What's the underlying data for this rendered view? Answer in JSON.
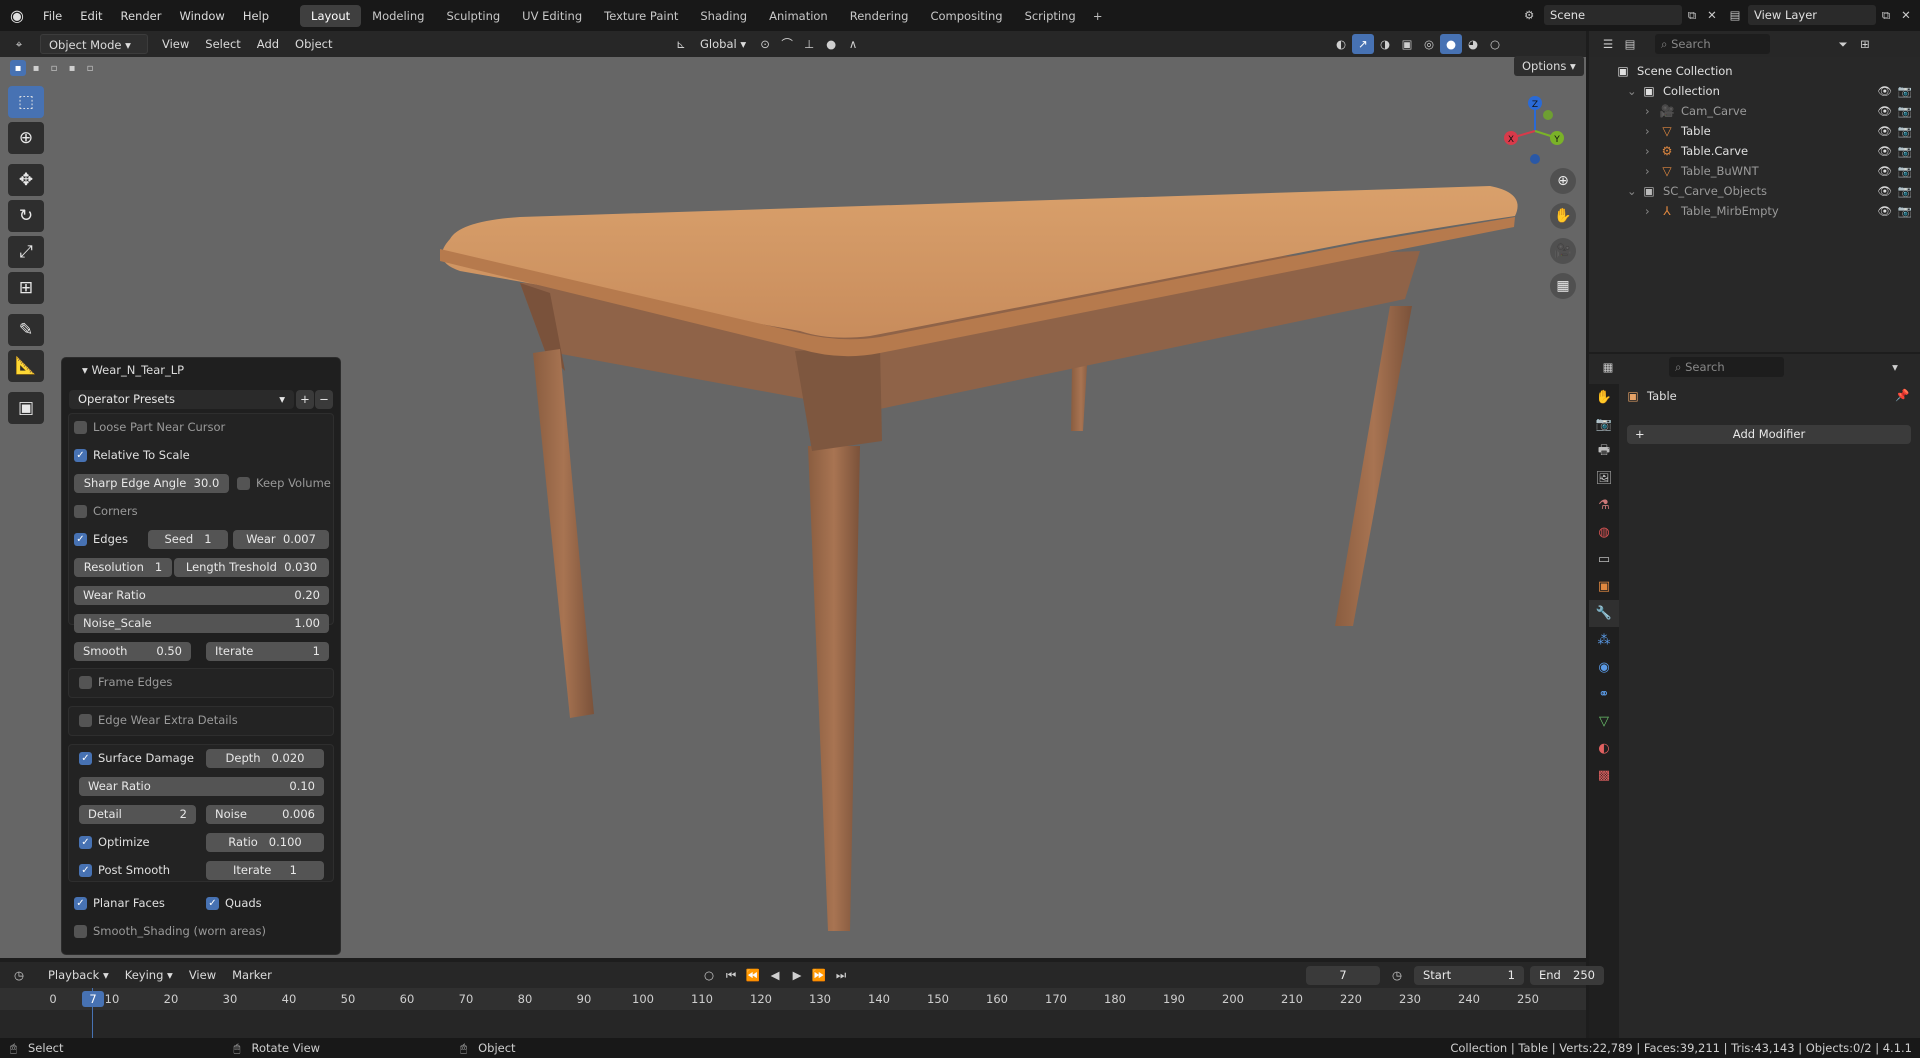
{
  "menu": [
    "File",
    "Edit",
    "Render",
    "Window",
    "Help"
  ],
  "workspaces": [
    {
      "label": "Layout",
      "active": true
    },
    {
      "label": "Modeling"
    },
    {
      "label": "Sculpting"
    },
    {
      "label": "UV Editing"
    },
    {
      "label": "Texture Paint"
    },
    {
      "label": "Shading"
    },
    {
      "label": "Animation"
    },
    {
      "label": "Rendering"
    },
    {
      "label": "Compositing"
    },
    {
      "label": "Scripting"
    }
  ],
  "scene_name": "Scene",
  "view_layer": "View Layer",
  "viewport": {
    "mode": "Object Mode",
    "menus": [
      "View",
      "Select",
      "Add",
      "Object"
    ],
    "transform_orientation": "Global",
    "options_label": "Options",
    "gizmo": {
      "x": "X",
      "y": "Y",
      "z": "Z"
    }
  },
  "operator_panel": {
    "title": "Wear_N_Tear_LP",
    "presets": "Operator Presets",
    "loose_part": "Loose Part Near Cursor",
    "relative_scale": "Relative To Scale",
    "sharp_edge": {
      "label": "Sharp Edge Angle",
      "value": "30.0"
    },
    "keep_volume": "Keep Volume",
    "corners": "Corners",
    "edges": "Edges",
    "seed": {
      "label": "Seed",
      "value": "1"
    },
    "wear": {
      "label": "Wear",
      "value": "0.007"
    },
    "resolution": {
      "label": "Resolution",
      "value": "1"
    },
    "length_threshold": {
      "label": "Length Treshold",
      "value": "0.030"
    },
    "wear_ratio": {
      "label": "Wear Ratio",
      "value": "0.20"
    },
    "noise_scale": {
      "label": "Noise_Scale",
      "value": "1.00"
    },
    "smooth": {
      "label": "Smooth",
      "value": "0.50"
    },
    "iterate": {
      "label": "Iterate",
      "value": "1"
    },
    "frame_edges": "Frame Edges",
    "edge_wear_extra": "Edge Wear Extra Details",
    "surface_damage": "Surface Damage",
    "depth": {
      "label": "Depth",
      "value": "0.020"
    },
    "sd_wear_ratio": {
      "label": "Wear Ratio",
      "value": "0.10"
    },
    "detail": {
      "label": "Detail",
      "value": "2"
    },
    "noise": {
      "label": "Noise",
      "value": "0.006"
    },
    "optimize": "Optimize",
    "ratio": {
      "label": "Ratio",
      "value": "0.100"
    },
    "post_smooth": "Post Smooth",
    "ps_iterate": {
      "label": "Iterate",
      "value": "1"
    },
    "planar_faces": "Planar Faces",
    "quads": "Quads",
    "smooth_shading": "Smooth_Shading (worn areas)"
  },
  "outliner": {
    "search_placeholder": "Search",
    "scene_collection": "Scene Collection",
    "rows": [
      {
        "label": "Collection",
        "indent": 1
      },
      {
        "label": "Cam_Carve",
        "indent": 2,
        "dim": true
      },
      {
        "label": "Table",
        "indent": 2
      },
      {
        "label": "Table.Carve",
        "indent": 2
      },
      {
        "label": "Table_BuWNT",
        "indent": 2,
        "dim": true
      },
      {
        "label": "SC_Carve_Objects",
        "indent": 1,
        "dim": true
      },
      {
        "label": "Table_MirbEmpty",
        "indent": 2,
        "dim": true
      }
    ]
  },
  "properties": {
    "search_placeholder": "Search",
    "object_name": "Table",
    "add_modifier": "Add Modifier"
  },
  "timeline": {
    "menus": [
      "Playback",
      "Keying",
      "View",
      "Marker"
    ],
    "current_frame": "7",
    "start_label": "Start",
    "start": "1",
    "end_label": "End",
    "end": "250",
    "ticks": [
      "0",
      "10",
      "20",
      "30",
      "40",
      "50",
      "60",
      "70",
      "80",
      "90",
      "100",
      "110",
      "120",
      "130",
      "140",
      "150",
      "160",
      "170",
      "180",
      "190",
      "200",
      "210",
      "220",
      "230",
      "240",
      "250"
    ]
  },
  "status": {
    "select": "Select",
    "rotate": "Rotate View",
    "object": "Object",
    "stats": "Collection | Table | Verts:22,789 | Faces:39,211 | Tris:43,143 | Objects:0/2 | 4.1.1"
  }
}
